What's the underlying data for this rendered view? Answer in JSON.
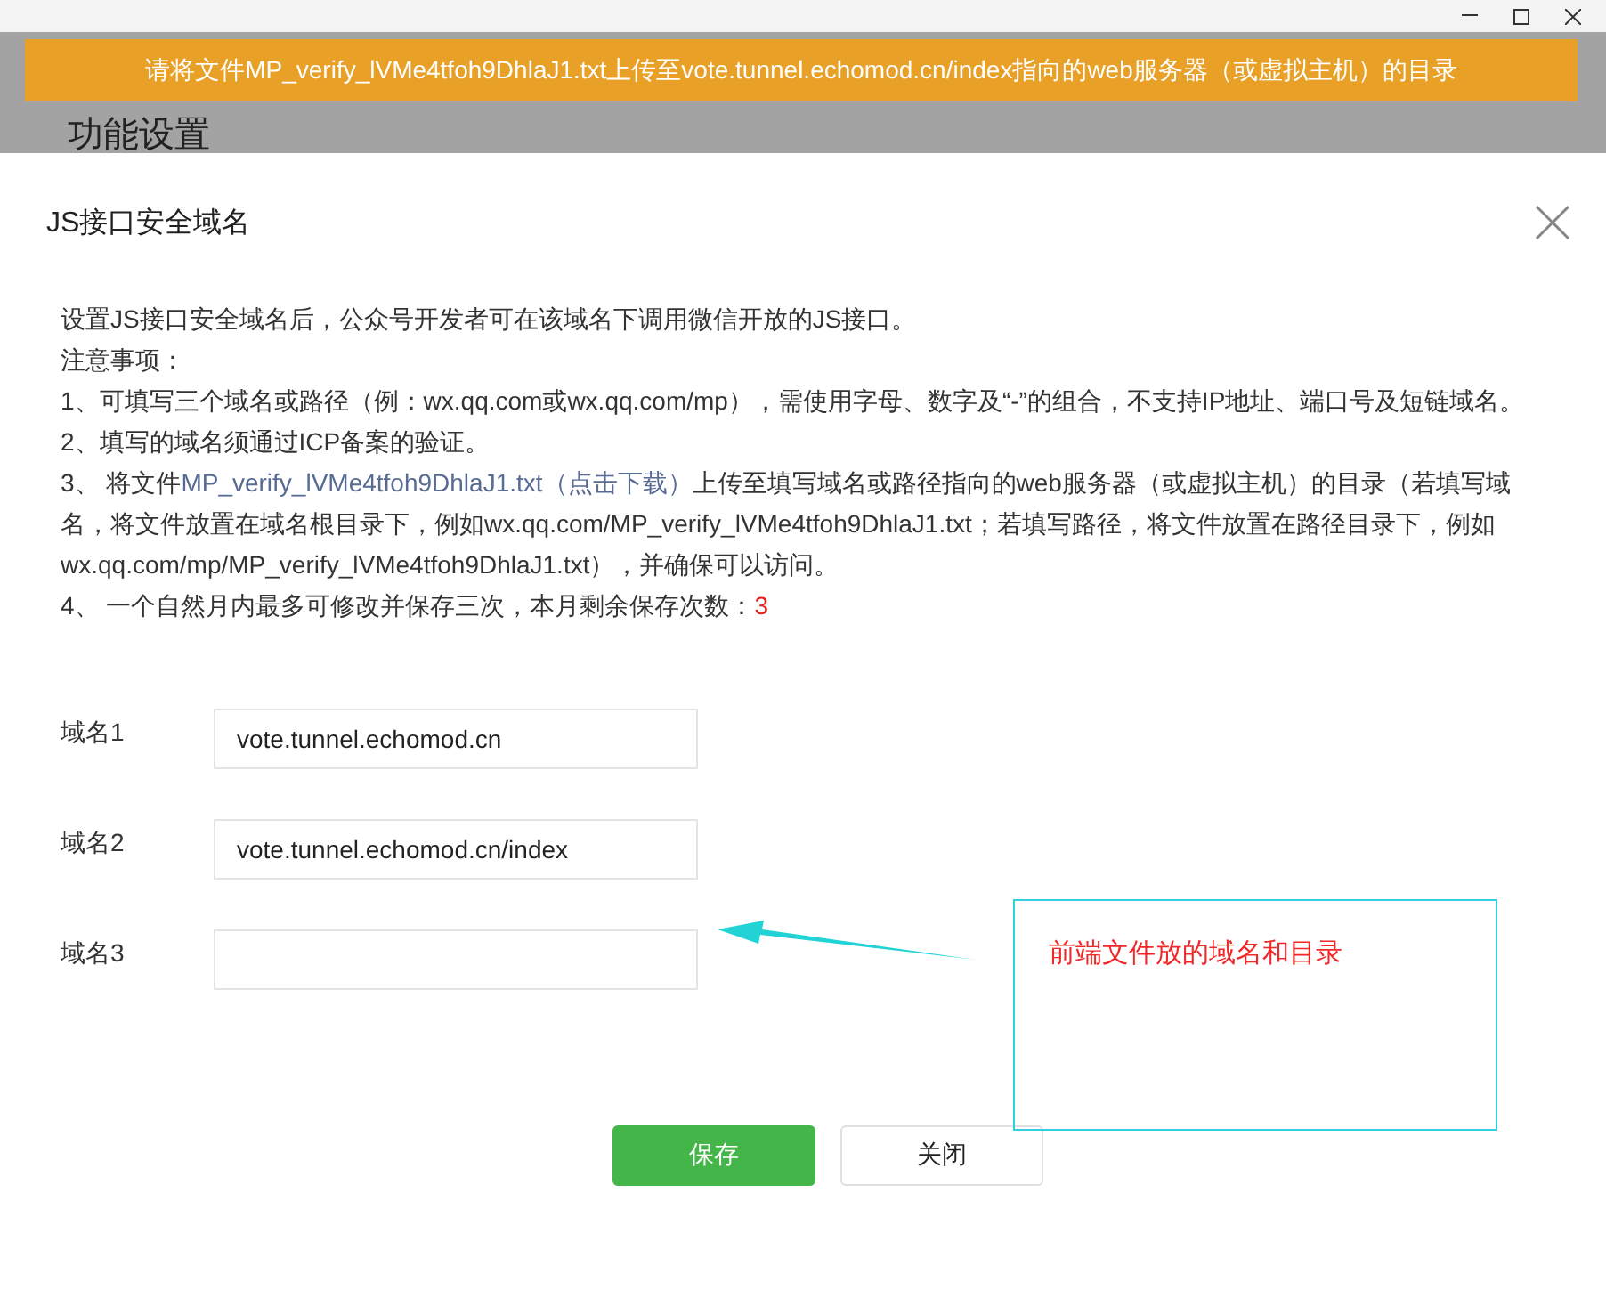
{
  "banner": {
    "text": "请将文件MP_verify_lVMe4tfoh9DhlaJ1.txt上传至vote.tunnel.echomod.cn/index指向的web服务器（或虚拟主机）的目录"
  },
  "background_heading": "功能设置",
  "dialog": {
    "title": "JS接口安全域名",
    "intro": "设置JS接口安全域名后，公众号开发者可在该域名下调用微信开放的JS接口。",
    "notes_heading": "注意事项：",
    "notes": [
      {
        "kind": "plain",
        "text": "1、可填写三个域名或路径（例：wx.qq.com或wx.qq.com/mp），需使用字母、数字及“-”的组合，不支持IP地址、端口号及短链域名。"
      },
      {
        "kind": "plain",
        "text": "2、填写的域名须通过ICP备案的验证。"
      },
      {
        "kind": "link",
        "before": "3、 将文件",
        "link": "MP_verify_lVMe4tfoh9DhlaJ1.txt（点击下载）",
        "after": "上传至填写域名或路径指向的web服务器（或虚拟主机）的目录（若填写域名，将文件放置在域名根目录下，例如wx.qq.com/MP_verify_lVMe4tfoh9DhlaJ1.txt；若填写路径，将文件放置在路径目录下，例如wx.qq.com/mp/MP_verify_lVMe4tfoh9DhlaJ1.txt），并确保可以访问。"
      },
      {
        "kind": "count",
        "before": "4、 一个自然月内最多可修改并保存三次，本月剩余保存次数：",
        "count": "3"
      }
    ],
    "fields": [
      {
        "label": "域名1",
        "value": "vote.tunnel.echomod.cn"
      },
      {
        "label": "域名2",
        "value": "vote.tunnel.echomod.cn/index"
      },
      {
        "label": "域名3"
      }
    ],
    "annotation": {
      "text": "前端文件放的域名和目录"
    },
    "buttons": [
      {
        "label": "保存",
        "kind": "primary"
      },
      {
        "label": "关闭",
        "kind": "default"
      }
    ]
  }
}
